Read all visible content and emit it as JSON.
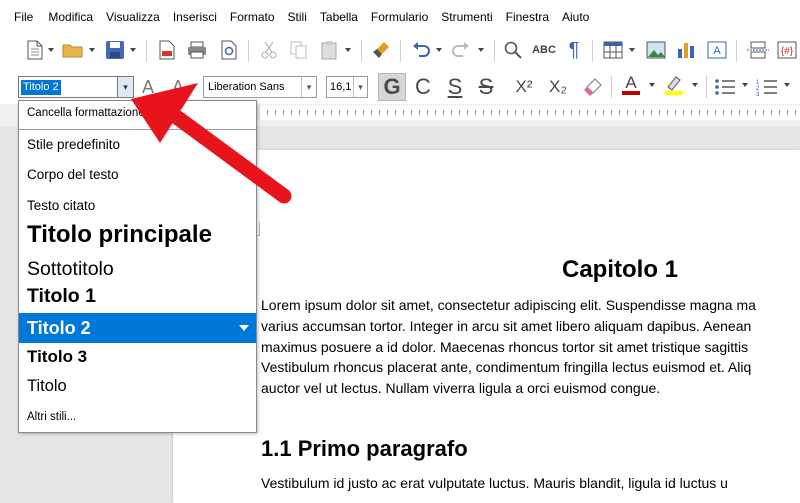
{
  "menu": [
    "File",
    "Modifica",
    "Visualizza",
    "Inserisci",
    "Formato",
    "Stili",
    "Tabella",
    "Formulario",
    "Strumenti",
    "Finestra",
    "Aiuto"
  ],
  "toolbar2": {
    "style_value": "Titolo 2",
    "font_name": "Liberation Sans",
    "font_size": "16,1",
    "bold": "G",
    "italic": "C",
    "underline": "S",
    "strike": "S",
    "superscript": "X²",
    "subscript": "X₂"
  },
  "style_list": {
    "clear": "Cancella formattazione",
    "items": [
      "Stile predefinito",
      "Corpo del testo",
      "Testo citato",
      "Titolo principale",
      "Sottotitolo",
      "Titolo 1",
      "Titolo 2",
      "Titolo 3",
      "Titolo"
    ],
    "more": "Altri stili..."
  },
  "document": {
    "title": "Capitolo 1",
    "body_lines": [
      "Lorem ipsum dolor sit amet, consectetur adipiscing elit. Suspendisse magna ma",
      "varius accumsan tortor. Integer in arcu sit amet libero aliquam dapibus. Aenean",
      "maximus posuere a id dolor. Maecenas rhoncus tortor sit amet tristique sagittis",
      "Vestibulum rhoncus placerat ante, condimentum fringilla lectus euismod et. Aliq",
      "auctor vel ut lectus. Nullam viverra ligula a orci euismod congue."
    ],
    "heading2": "1.1 Primo paragrafo",
    "body2_line": "Vestibulum id justo ac erat vulputate luctus. Mauris blandit, ligula id luctus u"
  },
  "colors": {
    "selection": "#0078d7",
    "annotation_arrow": "#e8141b",
    "save_icon": "#4169b0",
    "chart_icon": "#3a66b0"
  }
}
